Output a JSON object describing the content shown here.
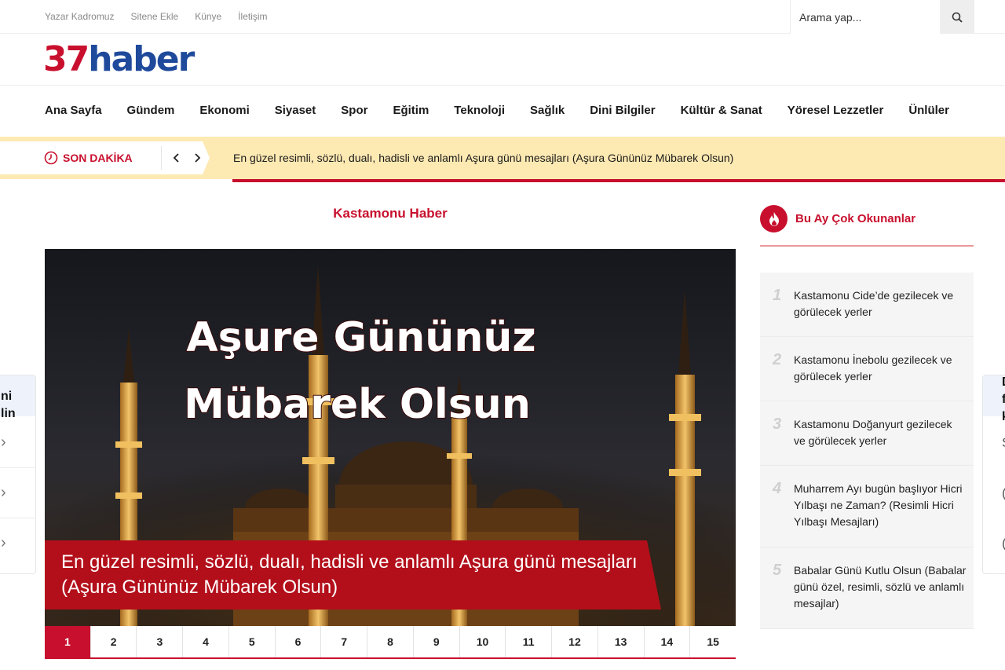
{
  "topbar": {
    "links": [
      "Yazar Kadromuz",
      "Sitene Ekle",
      "Künye",
      "İletişim"
    ],
    "search_placeholder": "Arama yap...",
    "search_icon": "search-icon"
  },
  "logo": {
    "number": "37",
    "word": "haber"
  },
  "nav": [
    "Ana Sayfa",
    "Gündem",
    "Ekonomi",
    "Siyaset",
    "Spor",
    "Eğitim",
    "Teknoloji",
    "Sağlık",
    "Dini Bilgiler",
    "Kültür & Sanat",
    "Yöresel Lezzetler",
    "Ünlüler"
  ],
  "breaking": {
    "label": "SON DAKİKA",
    "text": "En güzel resimli, sözlü, dualı, hadisli ve anlamlı Aşura günü mesajları (Aşura Gününüz Mübarek Olsun)",
    "icon": "clock-icon"
  },
  "main": {
    "section_title": "Kastamonu Haber",
    "slide": {
      "image_text_line1": "Aşure Gününüz",
      "image_text_line2": "Mübarek Olsun",
      "caption": "En güzel resimli, sözlü, dualı, hadisli ve anlamlı Aşura günü mesajları (Aşura Gününüz Mübarek Olsun)"
    },
    "pages": [
      "1",
      "2",
      "3",
      "4",
      "5",
      "6",
      "7",
      "8",
      "9",
      "10",
      "11",
      "12",
      "13",
      "14",
      "15"
    ],
    "active_page": "1"
  },
  "sidebar": {
    "title": "Bu Ay Çok Okunanlar",
    "icon": "fire-icon",
    "items": [
      {
        "num": "1",
        "text": "Kastamonu Cide’de gezilecek ve görülecek yerler"
      },
      {
        "num": "2",
        "text": "Kastamonu İnebolu gezilecek ve görülecek yerler"
      },
      {
        "num": "3",
        "text": "Kastamonu Doğanyurt gezilecek ve görülecek yerler"
      },
      {
        "num": "4",
        "text": "Muharrem Ayı bugün başlıyor Hicri Yılbaşı ne Zaman? (Resimli Hicri Yılbaşı Mesajları)"
      },
      {
        "num": "5",
        "text": "Babalar Günü Kutlu Olsun (Babalar günü özel, resimli, sözlü ve anlamlı mesajlar)"
      }
    ]
  },
  "edge_left": {
    "line1": "ni",
    "line2": "lin"
  },
  "edge_right": {
    "line1": "D",
    "line2": "f",
    "line3": "k",
    "glyphs": [
      "Ş",
      "(",
      "("
    ]
  },
  "colors": {
    "brand_red": "#c8102e",
    "brand_blue": "#1f4a9c",
    "breaking_bg": "#fde9b2"
  }
}
